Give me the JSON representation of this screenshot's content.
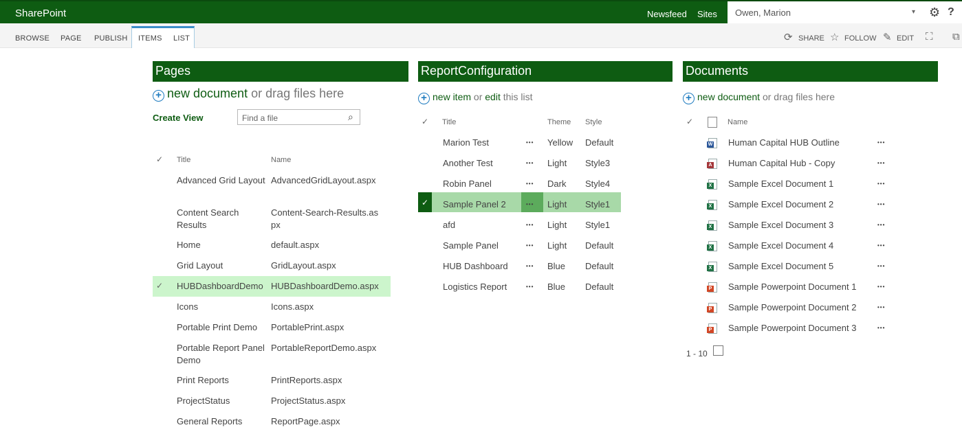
{
  "suite": {
    "brand": "SharePoint",
    "newsfeed": "Newsfeed",
    "sites": "Sites",
    "user": "Owen, Marion",
    "caret": "▾",
    "gear": "⚙",
    "help": "?"
  },
  "ribbon": {
    "tabs": [
      "BROWSE",
      "PAGE",
      "PUBLISH",
      "ITEMS",
      "LIST"
    ],
    "share": "SHARE",
    "follow": "FOLLOW",
    "edit": "EDIT"
  },
  "pages": {
    "title": "Pages",
    "new_document": "new document",
    "or_drag": "or drag files here",
    "create_view": "Create View",
    "search_placeholder": "Find a file",
    "columns": [
      "Title",
      "Name"
    ],
    "rows": [
      {
        "title": "Advanced Grid Layout",
        "name": "AdvancedGridLayout.aspx"
      },
      {
        "title": "Content Search Results",
        "name": "Content-Search-Results.aspx"
      },
      {
        "title": "Home",
        "name": "default.aspx"
      },
      {
        "title": "Grid Layout",
        "name": "GridLayout.aspx"
      },
      {
        "title": "HUBDashboardDemo",
        "name": "HUBDashboardDemo.aspx",
        "selected": true
      },
      {
        "title": "Icons",
        "name": "Icons.aspx"
      },
      {
        "title": "Portable Print Demo",
        "name": "PortablePrint.aspx"
      },
      {
        "title": "Portable Report Panel Demo",
        "name": "PortableReportDemo.aspx"
      },
      {
        "title": "Print Reports",
        "name": "PrintReports.aspx"
      },
      {
        "title": "ProjectStatus",
        "name": "ProjectStatus.aspx"
      },
      {
        "title": "General Reports",
        "name": "ReportPage.aspx"
      }
    ]
  },
  "report": {
    "title": "ReportConfiguration",
    "new_item": "new item",
    "or": "or",
    "edit": "edit",
    "this_list": "this list",
    "columns": [
      "Title",
      "Theme",
      "Style"
    ],
    "rows": [
      {
        "title": "Marion Test",
        "theme": "Yellow",
        "style": "Default"
      },
      {
        "title": "Another Test",
        "theme": "Light",
        "style": "Style3"
      },
      {
        "title": "Robin Panel",
        "theme": "Dark",
        "style": "Style4"
      },
      {
        "title": "Sample Panel 2",
        "theme": "Light",
        "style": "Style1",
        "selected": true
      },
      {
        "title": "afd",
        "theme": "Light",
        "style": "Style1"
      },
      {
        "title": "Sample Panel",
        "theme": "Light",
        "style": "Default"
      },
      {
        "title": "HUB Dashboard",
        "theme": "Blue",
        "style": "Default"
      },
      {
        "title": "Logistics Report",
        "theme": "Blue",
        "style": "Default"
      }
    ]
  },
  "documents": {
    "title": "Documents",
    "new_document": "new document",
    "or_drag": "or drag files here",
    "column_name": "Name",
    "rows": [
      {
        "name": "Human Capital HUB Outline",
        "icon": "word",
        "glyph": "W"
      },
      {
        "name": "Human Capital Hub - Copy",
        "icon": "access",
        "glyph": "A"
      },
      {
        "name": "Sample Excel Document 1",
        "icon": "excel",
        "glyph": "X"
      },
      {
        "name": "Sample Excel Document 2",
        "icon": "excel",
        "glyph": "X"
      },
      {
        "name": "Sample Excel Document 3",
        "icon": "excel",
        "glyph": "X"
      },
      {
        "name": "Sample Excel Document 4",
        "icon": "excel",
        "glyph": "X"
      },
      {
        "name": "Sample Excel Document 5",
        "icon": "excel",
        "glyph": "X"
      },
      {
        "name": "Sample Powerpoint Document 1",
        "icon": "ppt",
        "glyph": "P"
      },
      {
        "name": "Sample Powerpoint Document 2",
        "icon": "ppt",
        "glyph": "P"
      },
      {
        "name": "Sample Powerpoint Document 3",
        "icon": "ppt",
        "glyph": "P"
      }
    ],
    "paging": "1 - 10"
  },
  "colors": {
    "brand_green": "#0e5c12",
    "selected_row": "#ccf5cc",
    "selected_row_report": "#a8d9a8",
    "selected_check": "#0e5c12",
    "link_blue": "#1f7cc0"
  }
}
